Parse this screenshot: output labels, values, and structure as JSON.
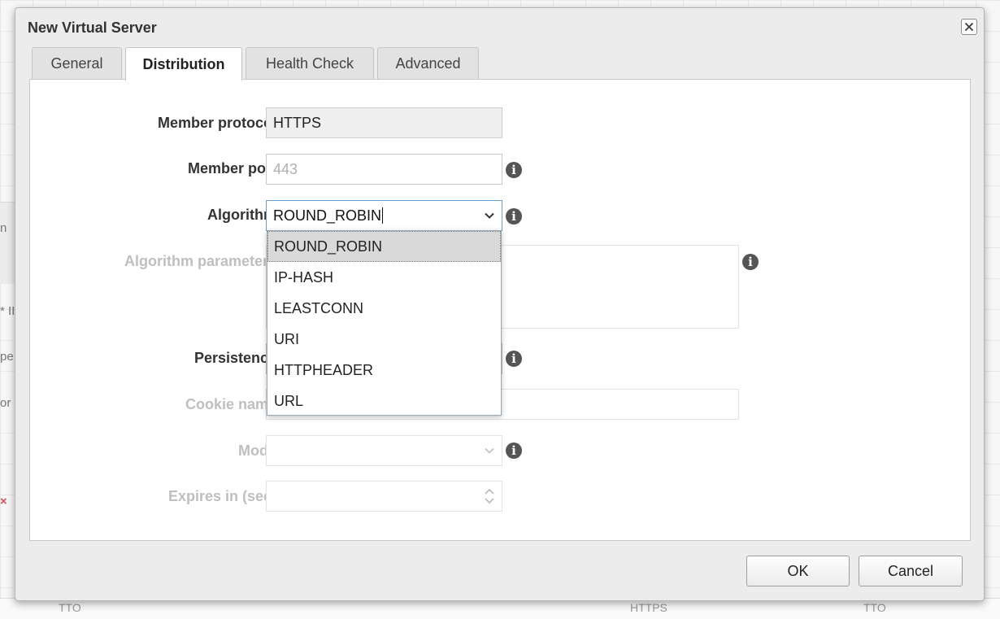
{
  "dialog": {
    "title": "New Virtual Server"
  },
  "tabs": [
    {
      "label": "General",
      "active": false
    },
    {
      "label": "Distribution",
      "active": true
    },
    {
      "label": "Health Check",
      "active": false
    },
    {
      "label": "Advanced",
      "active": false
    }
  ],
  "form": {
    "member_protocol": {
      "label": "Member protocol:",
      "value": "HTTPS"
    },
    "member_port": {
      "label": "Member port:",
      "placeholder": "443"
    },
    "algorithm": {
      "label": "Algorithm:",
      "value": "ROUND_ROBIN",
      "options": [
        "ROUND_ROBIN",
        "IP-HASH",
        "LEASTCONN",
        "URI",
        "HTTPHEADER",
        "URL"
      ],
      "selected_option": "ROUND_ROBIN"
    },
    "algorithm_parameters": {
      "label": "Algorithm parameters:"
    },
    "persistence": {
      "label": "Persistence:"
    },
    "cookie_name": {
      "label": "Cookie name:"
    },
    "mode": {
      "label": "Mode:"
    },
    "expires": {
      "label": "Expires in (sec):"
    }
  },
  "buttons": {
    "ok": "OK",
    "cancel": "Cancel"
  },
  "background": {
    "fragments": [
      "n",
      "* II",
      "pe",
      "or",
      "×"
    ],
    "bottom": [
      "TTO",
      "HTTPS",
      "TTO"
    ]
  },
  "colors": {
    "info_icon": "#555555",
    "focus_border": "#6aa0d8",
    "disabled_label": "#bfbfbf"
  },
  "icons": {
    "info": "info-icon",
    "close": "close-icon",
    "dropdown": "chevron-down-icon",
    "spinner": "spinner-arrows-icon"
  }
}
